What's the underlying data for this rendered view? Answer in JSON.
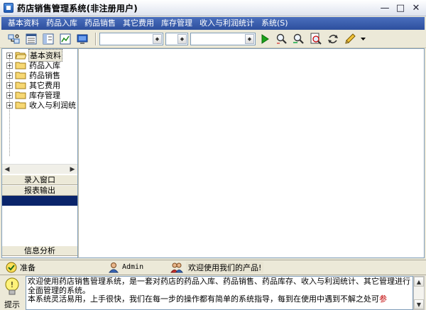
{
  "window": {
    "title": "药店销售管理系统(非注册用户)",
    "controls": [
      "—",
      "□",
      "✕"
    ]
  },
  "menu": [
    "基本资料",
    "药品入库",
    "药品销售",
    "其它费用",
    "库存管理",
    "收入与利润统计",
    "系统(S)"
  ],
  "toolbar": {
    "left_icons": [
      "cut-connect-icon",
      "list-view-icon",
      "detail-view-icon",
      "chart-view-icon",
      "monitor-icon"
    ],
    "right_icons": [
      "run-icon",
      "find-icon",
      "find-next-icon",
      "preview-icon",
      "refresh-icon",
      "pencil-icon"
    ],
    "combo_1_value": "",
    "combo_2_value": "",
    "combo_3_value": ""
  },
  "tree": {
    "items": [
      {
        "label": "基本资料",
        "selected": true,
        "open": true
      },
      {
        "label": "药品入库",
        "selected": false,
        "open": false
      },
      {
        "label": "药品销售",
        "selected": false,
        "open": false
      },
      {
        "label": "其它费用",
        "selected": false,
        "open": false
      },
      {
        "label": "库存管理",
        "selected": false,
        "open": false
      },
      {
        "label": "收入与利润统",
        "selected": false,
        "open": false
      }
    ]
  },
  "outlook": {
    "entry_window": "录入窗口",
    "report_output": "报表输出",
    "info_analysis": "信息分析"
  },
  "status": {
    "ready": "准备",
    "user": "Admin",
    "welcome": "欢迎使用我们的产品!"
  },
  "tip": {
    "label": "提示",
    "line1": "欢迎使用药店销售管理系统，是一套对药店的药品入库、药品销售、药品库存、收入与利润统计、其它管理进行全面管理的系统。",
    "line2": "本系统灵活易用，上手很快，我们在每一步的操作都有简单的系统指导，每到在使用中遇到不解之处可",
    "line2_tail": "参"
  }
}
